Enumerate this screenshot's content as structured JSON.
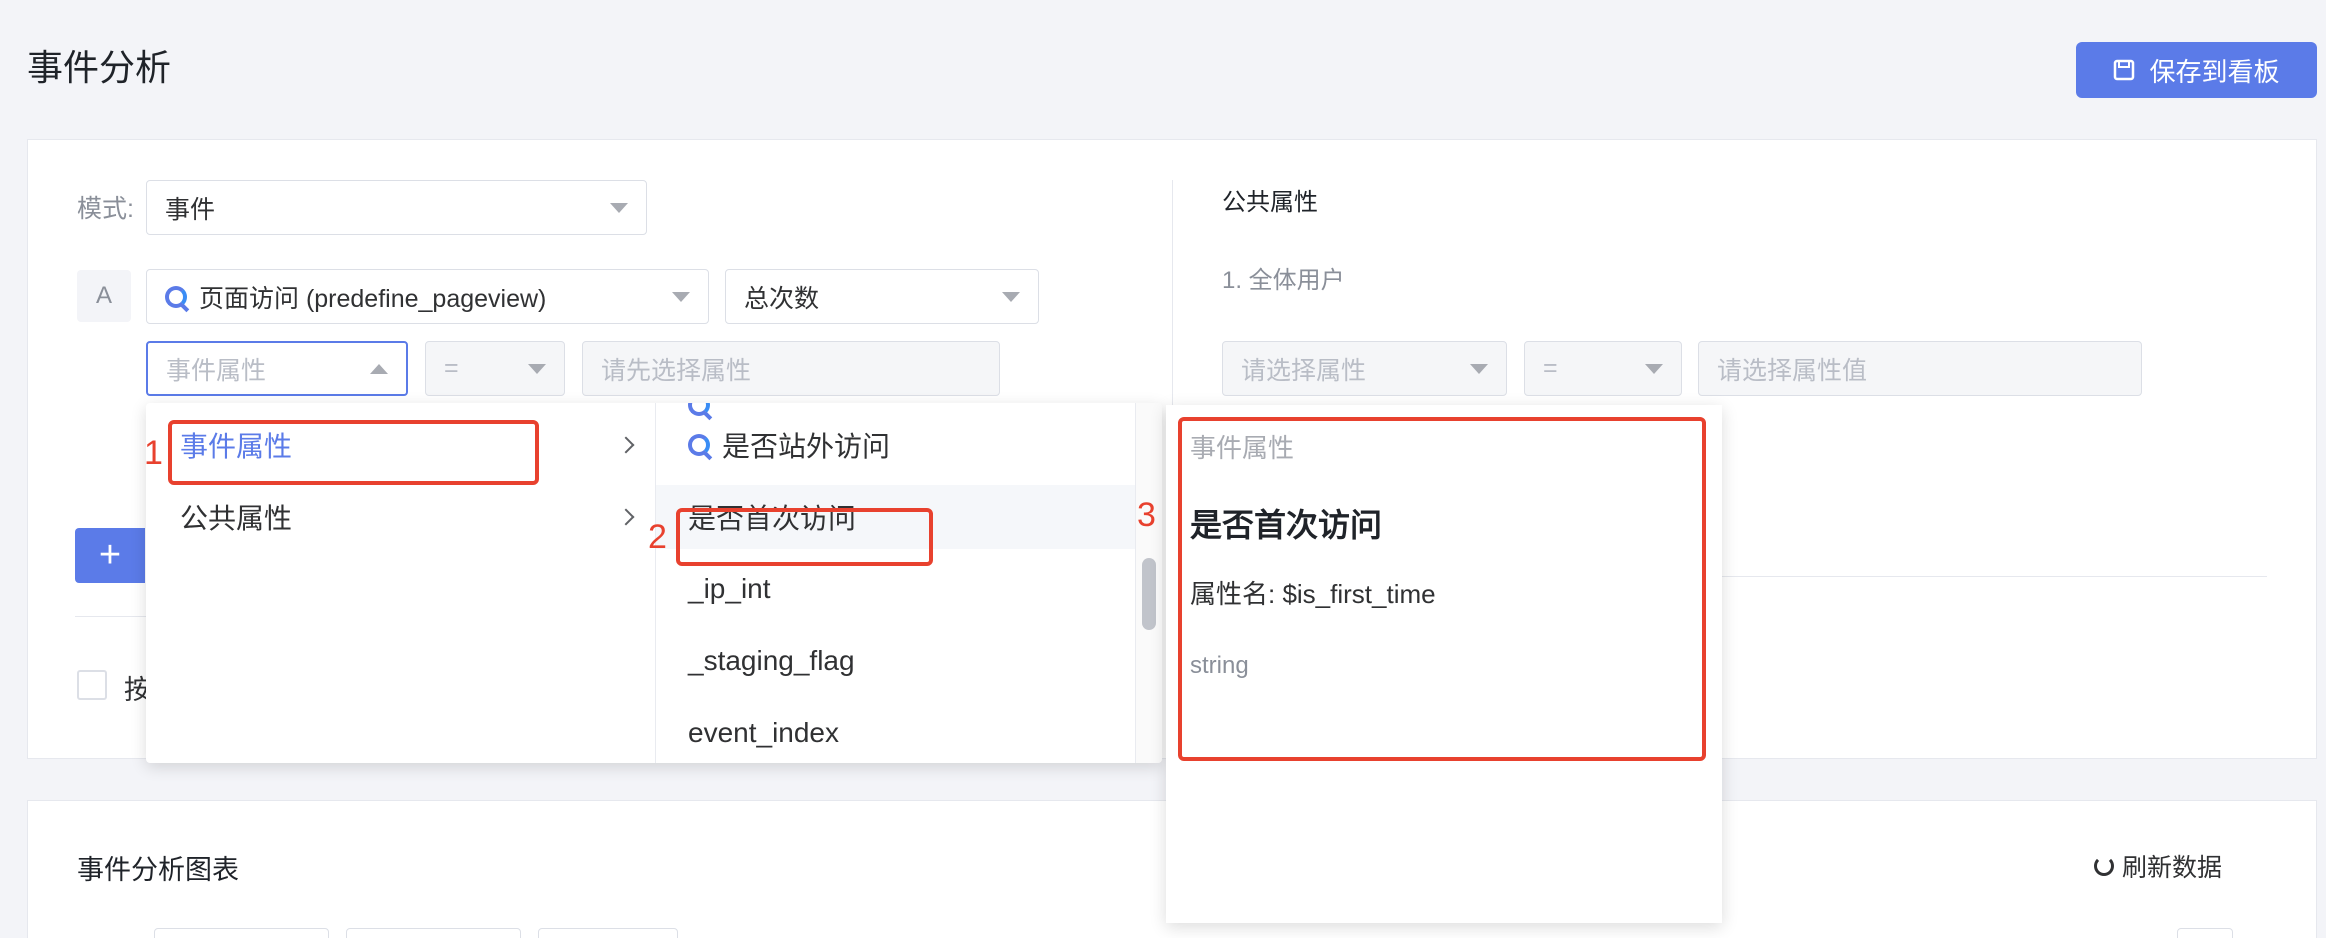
{
  "header": {
    "title": "事件分析",
    "save_label": "保存到看板"
  },
  "config": {
    "mode_label": "模式:",
    "mode_value": "事件",
    "row_badge": "A",
    "event_value": "页面访问 (predefine_pageview)",
    "count_value": "总次数",
    "prop_placeholder": "事件属性",
    "op_value": "=",
    "value_placeholder": "请先选择属性",
    "add_label": "+",
    "checkbox_label": "按"
  },
  "public": {
    "title": "公共属性",
    "user_group": "1. 全体用户",
    "prop_placeholder": "请选择属性",
    "op_value": "=",
    "value_placeholder": "请选择属性值"
  },
  "dropdown": {
    "categories": [
      {
        "label": "事件属性",
        "active": true
      },
      {
        "label": "公共属性",
        "active": false
      }
    ],
    "properties": [
      {
        "label": "是否站外访问",
        "icon": true
      },
      {
        "label": "是否首次访问",
        "icon": false,
        "highlighted": true
      },
      {
        "label": "_ip_int",
        "icon": false
      },
      {
        "label": "_staging_flag",
        "icon": false
      },
      {
        "label": "event_index",
        "icon": false
      }
    ]
  },
  "tooltip": {
    "category": "事件属性",
    "name": "是否首次访问",
    "key": "属性名: $is_first_time",
    "type": "string"
  },
  "annotations": [
    "1",
    "2",
    "3"
  ],
  "chart": {
    "title": "事件分析图表",
    "refresh_label": "刷新数据"
  },
  "colors": {
    "accent": "#5b7be8",
    "annotation": "#e8412e"
  }
}
